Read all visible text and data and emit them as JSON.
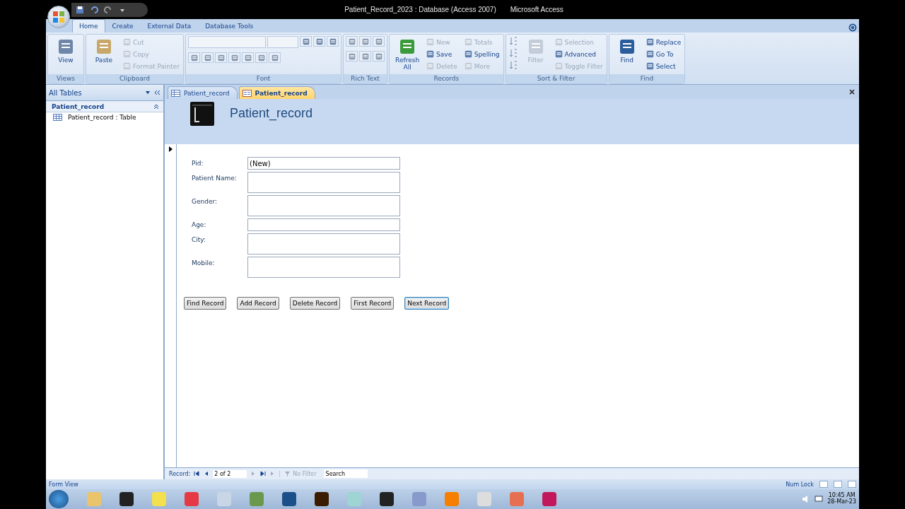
{
  "window": {
    "title_document": "Patient_Record_2023 : Database (Access 2007)",
    "title_app": "Microsoft Access"
  },
  "ribbon_tabs": [
    {
      "label": "Home",
      "selected": true
    },
    {
      "label": "Create",
      "selected": false
    },
    {
      "label": "External Data",
      "selected": false
    },
    {
      "label": "Database Tools",
      "selected": false
    }
  ],
  "ribbon_groups": [
    {
      "label": "Views",
      "kind": "items",
      "items": [
        {
          "label": "View",
          "kind": "large",
          "disabled": false
        }
      ]
    },
    {
      "label": "Clipboard",
      "kind": "items",
      "items": [
        {
          "label": "Paste",
          "kind": "large",
          "disabled": false
        },
        {
          "label": "Cut",
          "kind": "small",
          "disabled": true
        },
        {
          "label": "Copy",
          "kind": "small",
          "disabled": true
        },
        {
          "label": "Format Painter",
          "kind": "small",
          "disabled": true
        }
      ]
    },
    {
      "label": "Font",
      "kind": "font"
    },
    {
      "label": "Rich Text",
      "kind": "richtext"
    },
    {
      "label": "Records",
      "kind": "items",
      "items": [
        {
          "label": "Refresh All",
          "kind": "large",
          "disabled": false
        },
        {
          "label": "New",
          "kind": "small",
          "disabled": true
        },
        {
          "label": "Save",
          "kind": "small",
          "disabled": false
        },
        {
          "label": "Delete",
          "kind": "small",
          "disabled": true
        },
        {
          "label": "Totals",
          "kind": "small",
          "disabled": true
        },
        {
          "label": "Spelling",
          "kind": "small",
          "disabled": false
        },
        {
          "label": "More",
          "kind": "small",
          "disabled": true
        }
      ]
    },
    {
      "label": "Sort & Filter",
      "kind": "items",
      "items": [
        {
          "label": "Filter",
          "kind": "large",
          "disabled": true
        },
        {
          "label": "Selection",
          "kind": "small",
          "disabled": true
        },
        {
          "label": "Advanced",
          "kind": "small",
          "disabled": false
        },
        {
          "label": "Toggle Filter",
          "kind": "small",
          "disabled": true
        }
      ]
    },
    {
      "label": "Find",
      "kind": "items",
      "items": [
        {
          "label": "Find",
          "kind": "large",
          "disabled": false
        },
        {
          "label": "Replace",
          "kind": "small",
          "disabled": false
        },
        {
          "label": "Go To",
          "kind": "small",
          "disabled": false
        },
        {
          "label": "Select",
          "kind": "small",
          "disabled": false
        }
      ]
    }
  ],
  "nav_pane": {
    "header": "All Tables",
    "groups": [
      {
        "label": "Patient_record",
        "expanded": true,
        "children": [
          {
            "label": "Patient_record : Table"
          }
        ]
      }
    ]
  },
  "doc_tabs": [
    {
      "label": "Patient_record",
      "kind": "table",
      "selected": false
    },
    {
      "label": "Patient_record",
      "kind": "form",
      "selected": true
    }
  ],
  "form": {
    "title": "Patient_record",
    "fields": [
      {
        "label": "Pid:",
        "value": "(New)",
        "kind": "short"
      },
      {
        "label": "Patient Name:",
        "kind": "tall"
      },
      {
        "label": "Gender:",
        "kind": "tall"
      },
      {
        "label": "Age:",
        "kind": "short"
      },
      {
        "label": "City:",
        "kind": "tall"
      },
      {
        "label": "Mobile:",
        "kind": "tall"
      }
    ],
    "buttons": [
      {
        "label": "Find Record",
        "focused": false
      },
      {
        "label": "Add Record",
        "focused": false
      },
      {
        "label": "Delete Record",
        "focused": false
      },
      {
        "label": "First Record",
        "focused": false
      },
      {
        "label": "Next Record",
        "focused": true
      }
    ]
  },
  "record_nav": {
    "label": "Record:",
    "position": "2 of 2",
    "filter": "No Filter",
    "search_placeholder": "Search"
  },
  "status_bar": {
    "view": "Form View",
    "indicator": "Num Lock"
  },
  "taskbar": {
    "time": "10:45 AM",
    "date": "28-Mar-23"
  }
}
